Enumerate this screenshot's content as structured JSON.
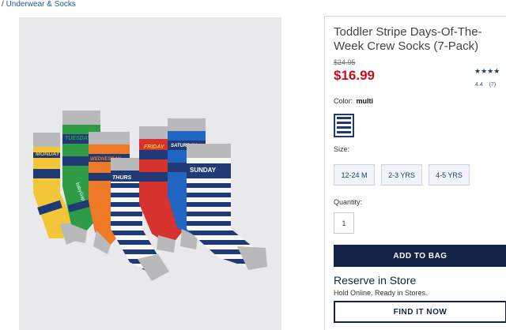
{
  "breadcrumb": {
    "separator": "/",
    "link": "Underwear & Socks"
  },
  "product": {
    "title": "Toddler Stripe Days-Of-The-Week Crew Socks (7-Pack)",
    "old_price": "$24.95",
    "price": "$16.99",
    "stars": "★★★★",
    "rating_value": "4.4",
    "rating_count": "(7)",
    "rating_stars_fraction": 0.88
  },
  "color": {
    "label": "Color:",
    "value": "multi"
  },
  "size": {
    "label": "Size:",
    "options": [
      "12-24 M",
      "2-3 YRS",
      "4-5 YRS"
    ]
  },
  "quantity": {
    "label": "Quantity:",
    "value": "1"
  },
  "actions": {
    "add_to_bag": "ADD TO BAG",
    "find_it_now": "FIND IT NOW"
  },
  "reserve": {
    "title": "Reserve in Store",
    "subtitle": "Hold Online. Ready in Stores."
  },
  "image": {
    "sock_labels": [
      "MONDAY",
      "TUESDAY",
      "WEDNESDAY",
      "THURS",
      "FRIDAY",
      "SATURDAY",
      "SUNDAY"
    ],
    "brand_mark": "babyGap",
    "colors": {
      "background": "#e9e9ec",
      "navy": "#1f3a75",
      "yellow": "#f3c63a",
      "green": "#2e9b45",
      "orange": "#ef7a26",
      "red": "#d7322e",
      "blue": "#2266c4",
      "white": "#f7f7f7",
      "gray": "#b9b9bc",
      "price_red": "#c40f1e",
      "button_navy": "#122347"
    }
  }
}
